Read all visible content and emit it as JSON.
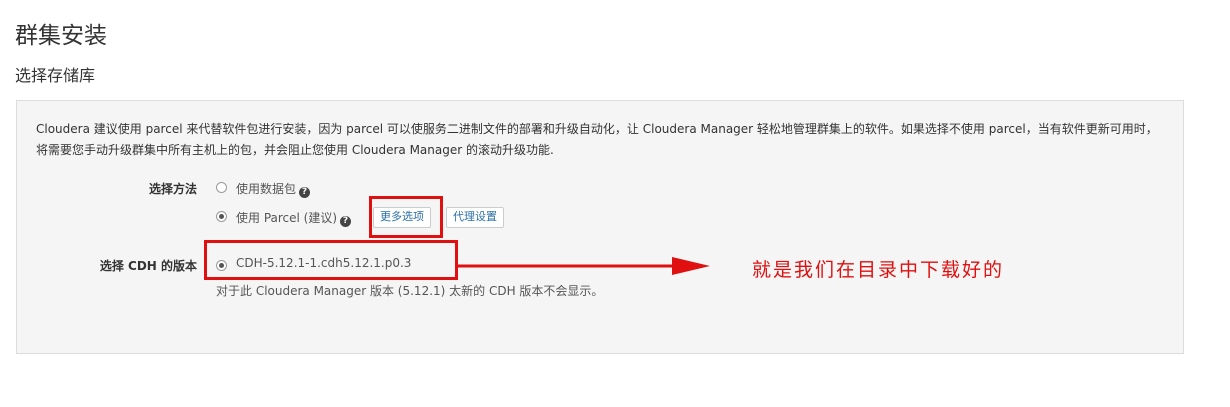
{
  "page": {
    "title": "群集安装",
    "step_title": "选择存储库"
  },
  "panel": {
    "description": "Cloudera 建议使用 parcel 来代替软件包进行安装，因为 parcel 可以使服务二进制文件的部署和升级自动化，让 Cloudera Manager 轻松地管理群集上的软件。如果选择不使用 parcel，当有软件更新可用时，将需要您手动升级群集中所有主机上的包，并会阻止您使用 Cloudera Manager 的滚动升级功能.",
    "method": {
      "label": "选择方法",
      "options": [
        {
          "label": "使用数据包",
          "selected": false
        },
        {
          "label": "使用 Parcel (建议)",
          "selected": true
        }
      ],
      "more_options_button": "更多选项",
      "proxy_settings_button": "代理设置"
    },
    "cdh": {
      "label": "选择 CDH 的版本",
      "option": "CDH-5.12.1-1.cdh5.12.1.p0.3",
      "selected": true,
      "note": "对于此 Cloudera Manager 版本 (5.12.1) 太新的 CDH 版本不会显示。"
    }
  },
  "annotation": {
    "text": "就是我们在目录中下载好的",
    "color": "#e01010"
  },
  "icons": {
    "help": "question-circle-icon",
    "radio": "radio-button",
    "arrow": "red-arrow-annotation"
  }
}
